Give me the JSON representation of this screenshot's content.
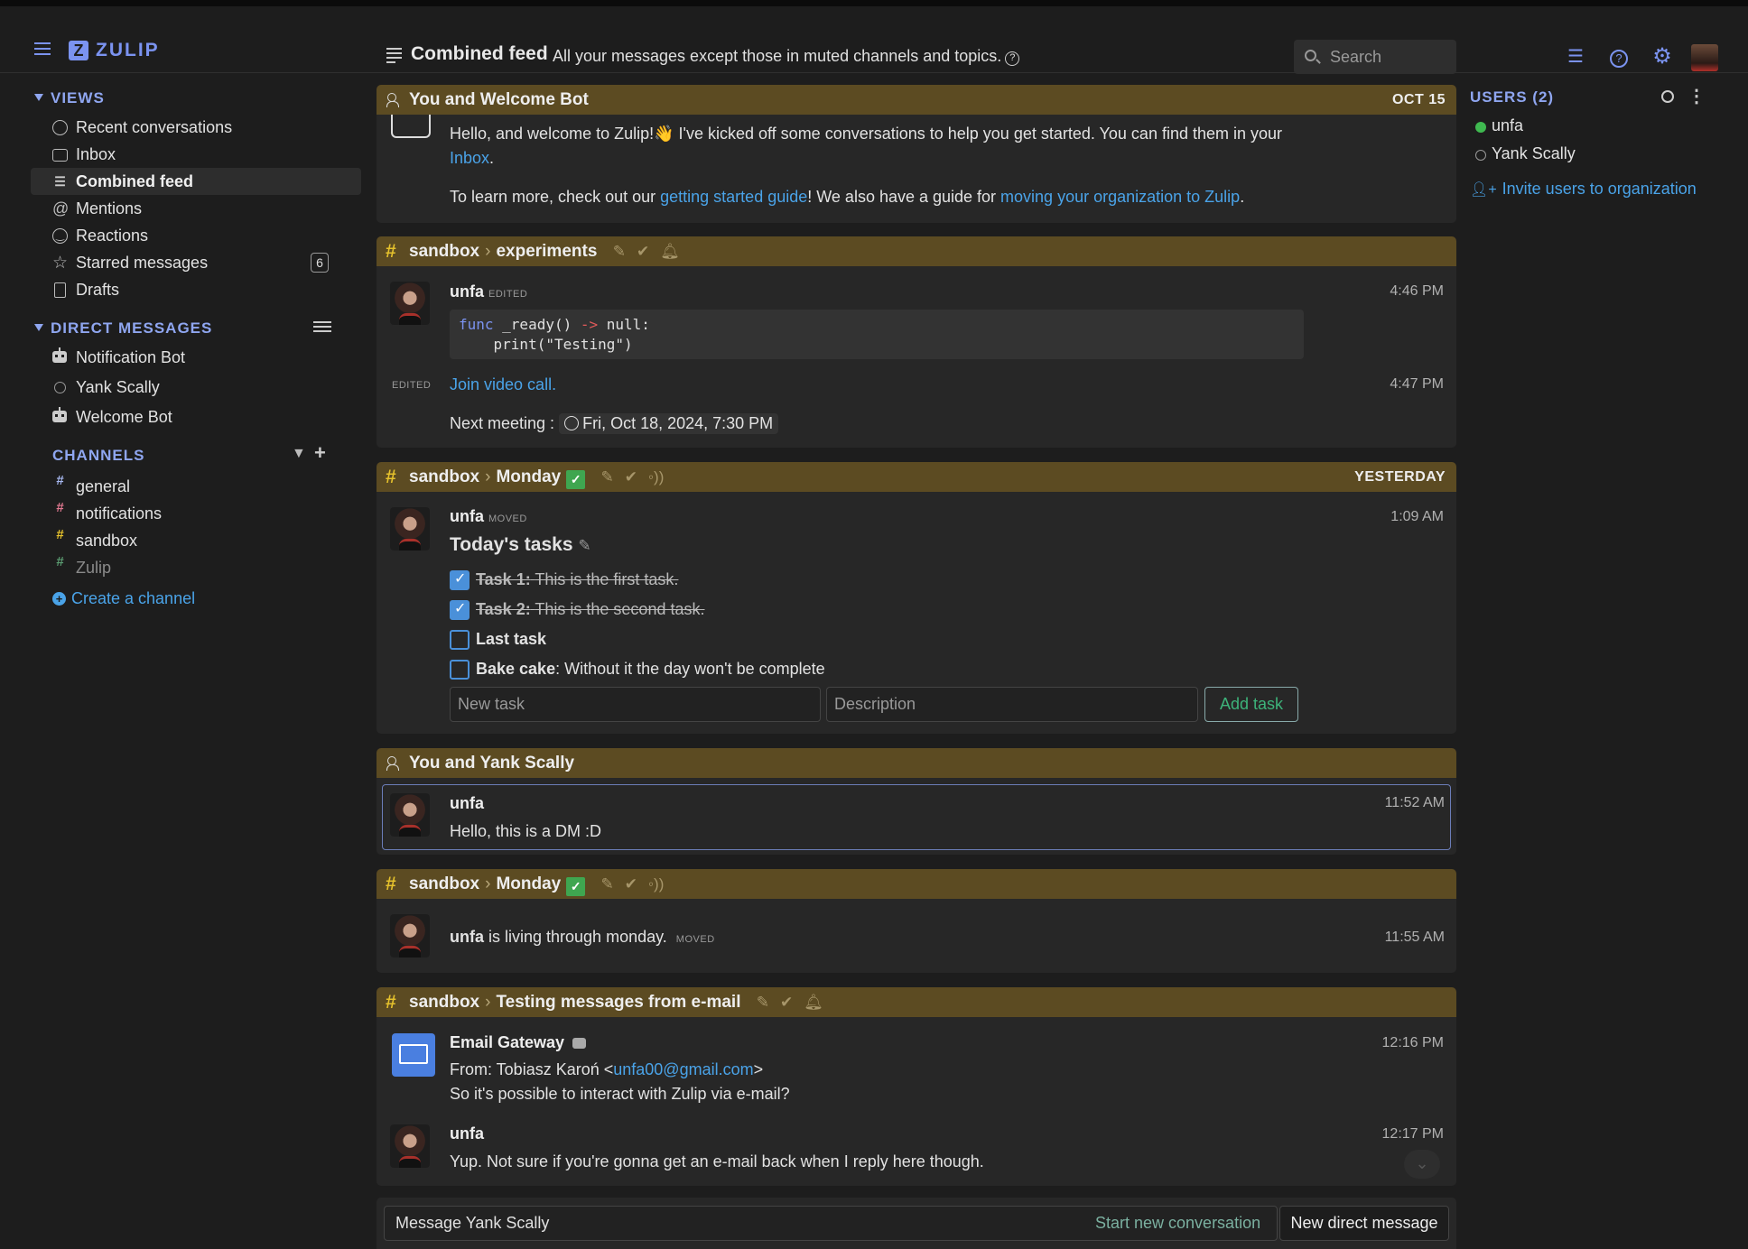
{
  "navbar": {
    "logo": "ZULIP",
    "title": "Combined feed",
    "description": "All your messages except those in muted channels and topics.",
    "search_placeholder": "Search"
  },
  "sidebar": {
    "views_header": "VIEWS",
    "views": [
      {
        "label": "Recent conversations",
        "icon": "clock-icon"
      },
      {
        "label": "Inbox",
        "icon": "inbox-icon"
      },
      {
        "label": "Combined feed",
        "icon": "feed-icon",
        "active": true
      },
      {
        "label": "Mentions",
        "icon": "at-icon"
      },
      {
        "label": "Reactions",
        "icon": "smile-icon"
      },
      {
        "label": "Starred messages",
        "icon": "star-icon",
        "badge": "6"
      },
      {
        "label": "Drafts",
        "icon": "draft-icon"
      }
    ],
    "dm_header": "DIRECT MESSAGES",
    "dms": [
      {
        "label": "Notification Bot",
        "icon": "bot-icon"
      },
      {
        "label": "Yank Scally",
        "icon": "offline-circle-icon"
      },
      {
        "label": "Welcome Bot",
        "icon": "bot-icon"
      }
    ],
    "channels_header": "CHANNELS",
    "channels": [
      {
        "label": "general",
        "color": "#a7b8f0"
      },
      {
        "label": "notifications",
        "color": "#e07890"
      },
      {
        "label": "sandbox",
        "color": "#e5c12c"
      },
      {
        "label": "Zulip",
        "color": "#5a9a70",
        "muted": true
      }
    ],
    "create_channel": "Create a channel"
  },
  "feed": {
    "r1": {
      "header": "You and Welcome Bot",
      "date": "OCT 15",
      "line1": "Hello, and welcome to Zulip!👋 I've kicked off some conversations to help you get started. You can find them in your",
      "inbox_link": "Inbox",
      "line2_a": "To learn more, check out our ",
      "guide_link": "getting started guide",
      "line2_b": "! We also have a guide for ",
      "moving_link": "moving your organization to Zulip",
      "line2_c": "."
    },
    "r2": {
      "channel": "sandbox",
      "topic": "experiments",
      "sender": "unfa",
      "edited_tag": "EDITED",
      "time1": "4:46 PM",
      "code_line1_kw": "func",
      "code_line1_rest": " _ready() ",
      "code_arrow": "->",
      "code_line1_end": " null:",
      "code_line2": "    print(\"Testing\")",
      "edited_left": "EDITED",
      "video_link": "Join video call.",
      "time2": "4:47 PM",
      "meeting_label": "Next meeting :",
      "meeting_time": "Fri, Oct 18, 2024, 7:30 PM"
    },
    "r3": {
      "channel": "sandbox",
      "topic": "Monday",
      "date": "YESTERDAY",
      "sender": "unfa",
      "moved_tag": "MOVED",
      "time": "1:09 AM",
      "todo_title": "Today's tasks",
      "tasks": [
        {
          "title": "Task 1:",
          "desc": "This is the first task.",
          "done": true
        },
        {
          "title": "Task 2:",
          "desc": "This is the second task.",
          "done": true
        },
        {
          "title": "Last task",
          "desc": "",
          "done": false
        },
        {
          "title": "Bake cake",
          "desc": ": Without it the day won't be complete",
          "done": false
        }
      ],
      "new_task_placeholder": "New task",
      "description_placeholder": "Description",
      "add_task": "Add task"
    },
    "r4": {
      "header": "You and Yank Scally",
      "sender": "unfa",
      "time": "11:52 AM",
      "text": "Hello, this is a DM :D"
    },
    "r5": {
      "channel": "sandbox",
      "topic": "Monday",
      "sender": "unfa",
      "text": " is living through monday.",
      "moved_tag": "MOVED",
      "time": "11:55 AM"
    },
    "r6": {
      "channel": "sandbox",
      "topic": "Testing messages from e-mail",
      "sender1": "Email Gateway",
      "time1": "12:16 PM",
      "from_a": "From: Tobiasz Karoń <",
      "email": "unfa00@gmail.com",
      "from_b": ">",
      "line2": "So it's possible to interact with Zulip via e-mail?",
      "sender2": "unfa",
      "time2": "12:17 PM",
      "reply": "Yup. Not sure if you're gonna get an e-mail back when I reply here though."
    }
  },
  "compose": {
    "recipient": "Message Yank Scally",
    "new_conversation": "Start new conversation",
    "new_dm": "New direct message"
  },
  "users": {
    "header": "USERS (2)",
    "list": [
      {
        "name": "unfa",
        "status": "active",
        "color": "#3fb950"
      },
      {
        "name": "Yank Scally",
        "status": "offline",
        "color": "#999999"
      }
    ],
    "invite": "Invite users to organization"
  }
}
